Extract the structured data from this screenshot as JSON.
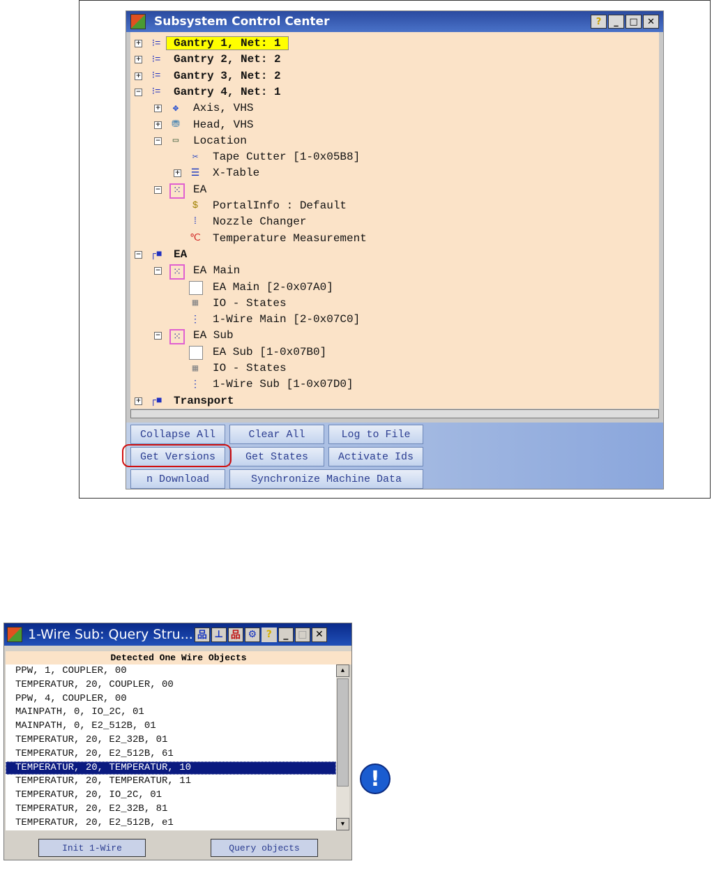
{
  "main_window": {
    "title": "Subsystem Control Center",
    "tree": [
      {
        "label": "Gantry 1, Net: 1",
        "level": 0,
        "expander": "+",
        "icon": "gantry-icon",
        "bold": true,
        "highlighted": true
      },
      {
        "label": "Gantry 2, Net: 2",
        "level": 0,
        "expander": "+",
        "icon": "gantry-icon",
        "bold": true
      },
      {
        "label": "Gantry 3, Net: 2",
        "level": 0,
        "expander": "+",
        "icon": "gantry-icon",
        "bold": true
      },
      {
        "label": "Gantry 4, Net: 1",
        "level": 0,
        "expander": "-",
        "icon": "gantry-icon",
        "bold": true
      },
      {
        "label": "Axis, VHS",
        "level": 1,
        "expander": "+",
        "icon": "axis-arrows-icon"
      },
      {
        "label": "Head, VHS",
        "level": 1,
        "expander": "+",
        "icon": "head-icon"
      },
      {
        "label": "Location",
        "level": 1,
        "expander": "-",
        "icon": "ruler-icon"
      },
      {
        "label": "Tape Cutter [1-0x05B8]",
        "level": 2,
        "expander": "",
        "icon": "scissors-icon"
      },
      {
        "label": "X-Table",
        "level": 2,
        "expander": "+",
        "icon": "table-icon"
      },
      {
        "label": "EA",
        "level": 1,
        "expander": "-",
        "icon": "ea-module-icon"
      },
      {
        "label": "PortalInfo : Default",
        "level": 2,
        "expander": "",
        "icon": "portal-info-icon"
      },
      {
        "label": "Nozzle Changer",
        "level": 2,
        "expander": "",
        "icon": "nozzle-icon"
      },
      {
        "label": "Temperature Measurement",
        "level": 2,
        "expander": "",
        "icon": "thermometer-icon"
      },
      {
        "label": "EA",
        "level": 0,
        "expander": "-",
        "icon": "group-icon",
        "bold": true
      },
      {
        "label": "EA Main",
        "level": 1,
        "expander": "-",
        "icon": "ea-module-icon"
      },
      {
        "label": "EA Main [2-0x07A0]",
        "level": 2,
        "expander": "",
        "icon": "box-icon"
      },
      {
        "label": "IO - States",
        "level": 2,
        "expander": "",
        "icon": "io-icon"
      },
      {
        "label": "1-Wire Main [2-0x07C0]",
        "level": 2,
        "expander": "",
        "icon": "one-wire-icon"
      },
      {
        "label": "EA Sub",
        "level": 1,
        "expander": "-",
        "icon": "ea-module-icon"
      },
      {
        "label": "EA Sub [1-0x07B0]",
        "level": 2,
        "expander": "",
        "icon": "box-icon"
      },
      {
        "label": "IO - States",
        "level": 2,
        "expander": "",
        "icon": "io-icon"
      },
      {
        "label": "1-Wire Sub [1-0x07D0]",
        "level": 2,
        "expander": "",
        "icon": "one-wire-icon"
      },
      {
        "label": "Transport",
        "level": 0,
        "expander": "+",
        "icon": "group-icon",
        "bold": true
      }
    ],
    "buttons": {
      "collapse_all": "Collapse All",
      "clear_all": "Clear All",
      "log_to_file": "Log to File",
      "get_versions": "Get Versions",
      "get_states": "Get States",
      "activate_ids": "Activate Ids",
      "download": "n Download",
      "synchronize": "Synchronize Machine Data"
    }
  },
  "query_window": {
    "title": "1-Wire Sub: Query Stru...",
    "header": "Detected One Wire Objects",
    "items": [
      "PPW, 1, COUPLER, 00",
      "TEMPERATUR, 20, COUPLER, 00",
      "PPW, 4, COUPLER, 00",
      "MAINPATH, 0, IO_2C, 01",
      "MAINPATH, 0, E2_512B, 01",
      "TEMPERATUR, 20, E2_32B, 01",
      "TEMPERATUR, 20, E2_512B, 61",
      "TEMPERATUR, 20, TEMPERATUR, 10",
      "TEMPERATUR, 20, TEMPERATUR, 11",
      "TEMPERATUR, 20, IO_2C, 01",
      "TEMPERATUR, 20, E2_32B, 81",
      "TEMPERATUR, 20, E2_512B, e1"
    ],
    "selected_index": 7,
    "buttons": {
      "init": "Init 1-Wire",
      "query": "Query objects"
    }
  }
}
